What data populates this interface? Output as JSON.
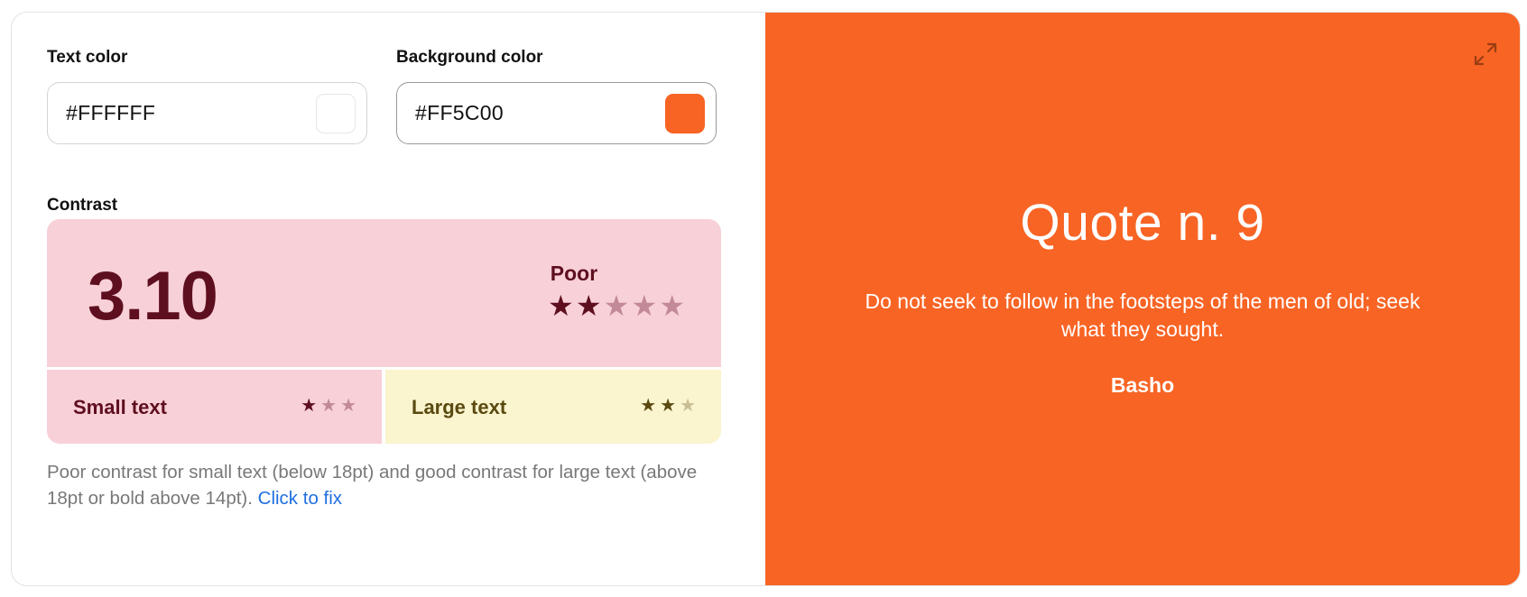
{
  "text_color": {
    "label": "Text color",
    "value": "#FFFFFF",
    "swatch": "#FFFFFF"
  },
  "background_color": {
    "label": "Background color",
    "value": "#FF5C00",
    "swatch": "#F86424"
  },
  "contrast": {
    "label": "Contrast",
    "ratio": "3.10",
    "rating": "Poor",
    "rating_stars": 2,
    "rating_stars_total": 5,
    "small_text": {
      "label": "Small text",
      "stars": 1,
      "total": 3
    },
    "large_text": {
      "label": "Large text",
      "stars": 2,
      "total": 3
    }
  },
  "description": {
    "text": "Poor contrast for small text (below 18pt) and good contrast for large text (above 18pt or bold above 14pt). ",
    "link": "Click to fix"
  },
  "preview": {
    "background": "#F86424",
    "title": "Quote n. 9",
    "quote": "Do not seek to follow in the footsteps of the men of old; seek what they sought.",
    "author": "Basho",
    "expand_icon": "expand-icon"
  },
  "colors": {
    "poor_bg": "#F8D0D8",
    "poor_fg": "#5E0F1F",
    "good_bg": "#FAF4CF",
    "good_fg": "#5A4A10",
    "link": "#1f6fe0"
  }
}
